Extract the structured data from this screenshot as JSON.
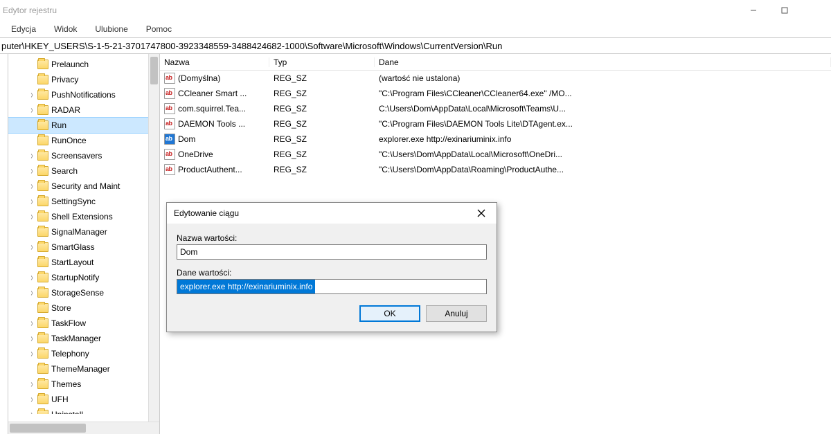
{
  "window": {
    "title": "Edytor rejestru"
  },
  "menu": {
    "edit": "Edycja",
    "view": "Widok",
    "favorites": "Ulubione",
    "help": "Pomoc"
  },
  "address": "puter\\HKEY_USERS\\S-1-5-21-3701747800-3923348559-3488424682-1000\\Software\\Microsoft\\Windows\\CurrentVersion\\Run",
  "tree": {
    "items": [
      {
        "label": "Prelaunch",
        "expandable": false
      },
      {
        "label": "Privacy",
        "expandable": false
      },
      {
        "label": "PushNotifications",
        "expandable": true
      },
      {
        "label": "RADAR",
        "expandable": true
      },
      {
        "label": "Run",
        "expandable": false,
        "selected": true
      },
      {
        "label": "RunOnce",
        "expandable": false
      },
      {
        "label": "Screensavers",
        "expandable": true
      },
      {
        "label": "Search",
        "expandable": true
      },
      {
        "label": "Security and Maint",
        "expandable": true
      },
      {
        "label": "SettingSync",
        "expandable": true
      },
      {
        "label": "Shell Extensions",
        "expandable": true
      },
      {
        "label": "SignalManager",
        "expandable": false
      },
      {
        "label": "SmartGlass",
        "expandable": true
      },
      {
        "label": "StartLayout",
        "expandable": false
      },
      {
        "label": "StartupNotify",
        "expandable": true
      },
      {
        "label": "StorageSense",
        "expandable": true
      },
      {
        "label": "Store",
        "expandable": false
      },
      {
        "label": "TaskFlow",
        "expandable": true
      },
      {
        "label": "TaskManager",
        "expandable": true
      },
      {
        "label": "Telephony",
        "expandable": true
      },
      {
        "label": "ThemeManager",
        "expandable": false
      },
      {
        "label": "Themes",
        "expandable": true
      },
      {
        "label": "UFH",
        "expandable": true
      },
      {
        "label": "Uninstall",
        "expandable": true
      }
    ]
  },
  "list": {
    "headers": {
      "name": "Nazwa",
      "type": "Typ",
      "data": "Dane"
    },
    "rows": [
      {
        "name": "(Domyślna)",
        "type": "REG_SZ",
        "data": "(wartość nie ustalona)"
      },
      {
        "name": "CCleaner Smart ...",
        "type": "REG_SZ",
        "data": "\"C:\\Program Files\\CCleaner\\CCleaner64.exe\" /MO..."
      },
      {
        "name": "com.squirrel.Tea...",
        "type": "REG_SZ",
        "data": "C:\\Users\\Dom\\AppData\\Local\\Microsoft\\Teams\\U..."
      },
      {
        "name": "DAEMON Tools ...",
        "type": "REG_SZ",
        "data": "\"C:\\Program Files\\DAEMON Tools Lite\\DTAgent.ex..."
      },
      {
        "name": "Dom",
        "type": "REG_SZ",
        "data": "explorer.exe http://exinariuminix.info",
        "selected": true
      },
      {
        "name": "OneDrive",
        "type": "REG_SZ",
        "data": "\"C:\\Users\\Dom\\AppData\\Local\\Microsoft\\OneDri..."
      },
      {
        "name": "ProductAuthent...",
        "type": "REG_SZ",
        "data": "\"C:\\Users\\Dom\\AppData\\Roaming\\ProductAuthe..."
      }
    ]
  },
  "dialog": {
    "title": "Edytowanie ciągu",
    "name_label": "Nazwa wartości:",
    "name_value": "Dom",
    "data_label": "Dane wartości:",
    "data_value": "explorer.exe http://exinariuminix.info",
    "ok": "OK",
    "cancel": "Anuluj"
  }
}
